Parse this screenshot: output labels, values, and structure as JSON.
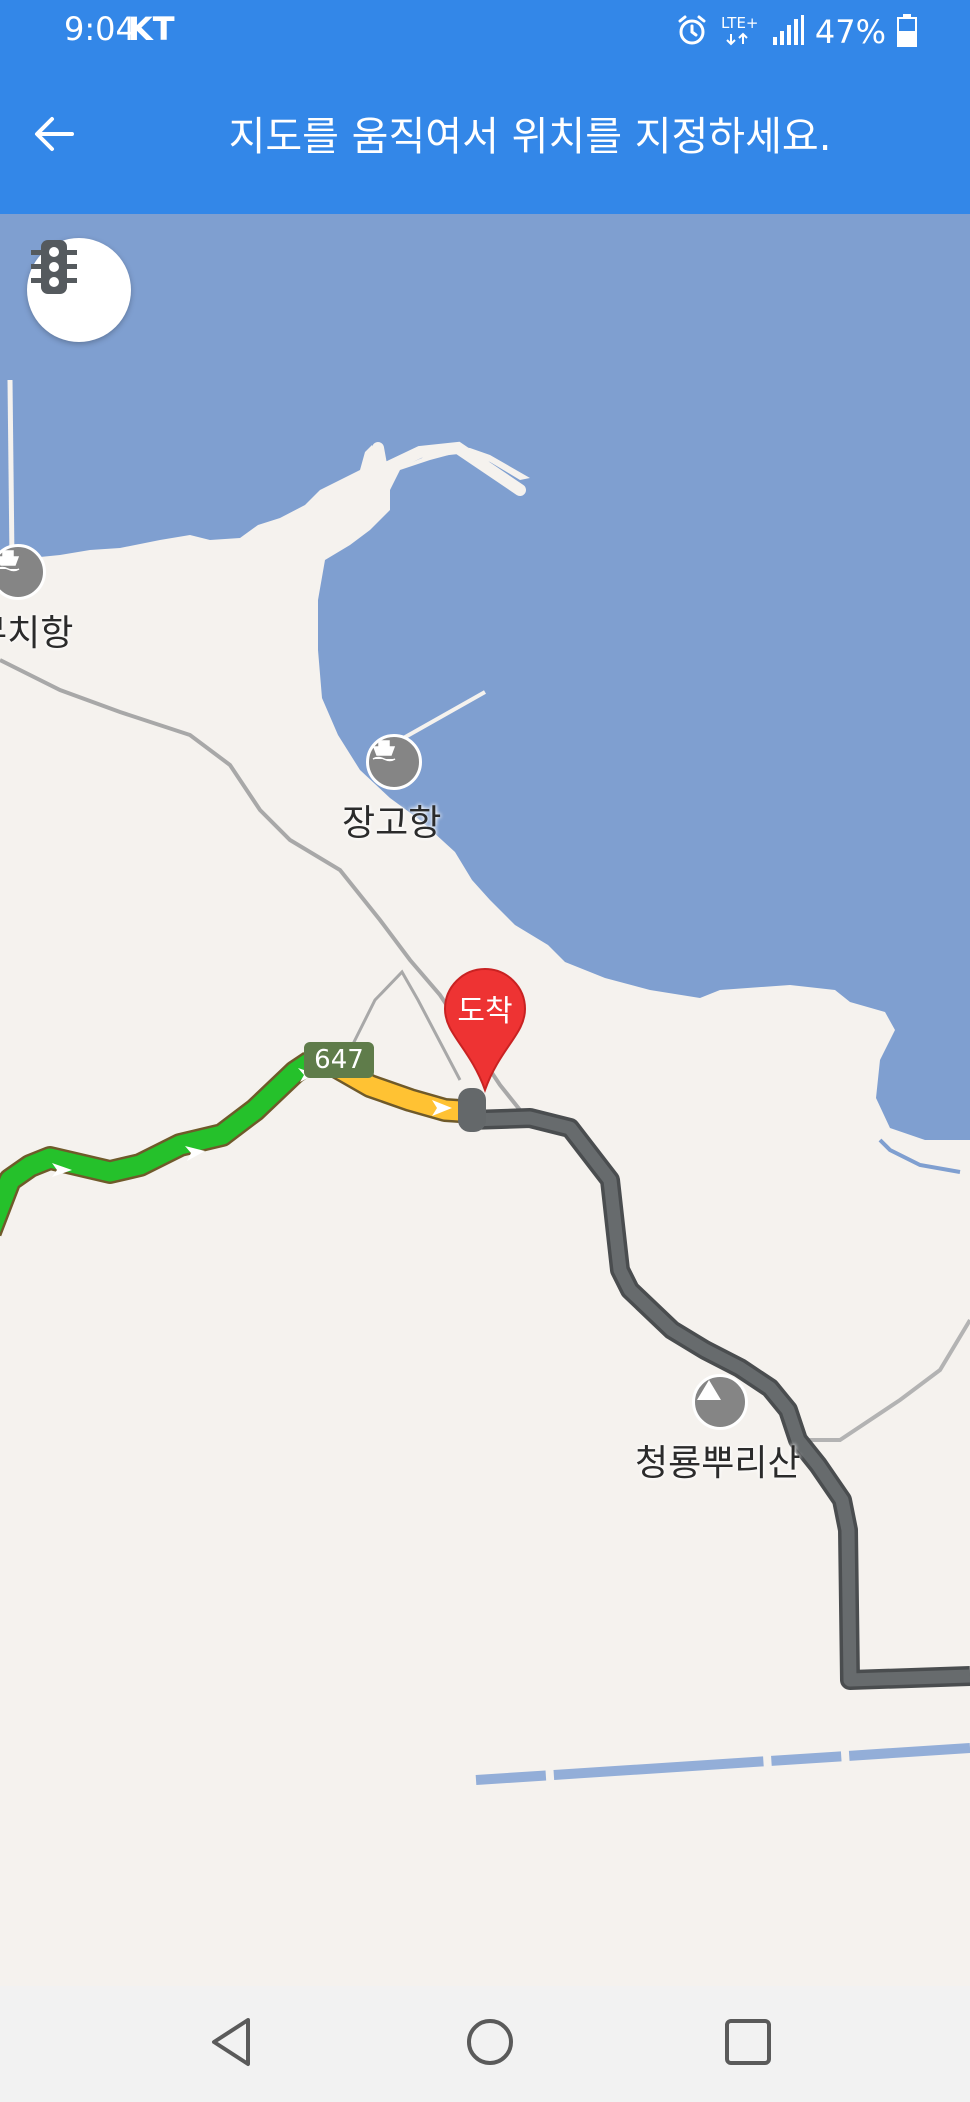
{
  "status_bar": {
    "time": "9:04",
    "carrier": "KT",
    "network": "LTE+",
    "battery": "47%",
    "icons": [
      "alarm-icon",
      "lte-icon",
      "signal-icon",
      "battery-icon"
    ]
  },
  "header": {
    "back_icon": "arrow-left-icon",
    "title": "지도를 움직여서 위치를 지정하세요."
  },
  "map": {
    "traffic_button_icon": "traffic-light-icon",
    "pois": [
      {
        "name": "무치항",
        "icon": "ferry-icon"
      },
      {
        "name": "장고항",
        "icon": "ferry-icon"
      },
      {
        "name": "청룡뿌리산",
        "icon": "mountain-icon"
      }
    ],
    "route_number": "647",
    "destination_label": "도착"
  },
  "nav_bar": {
    "icons": [
      "back-triangle-icon",
      "home-circle-icon",
      "recents-square-icon"
    ]
  },
  "colors": {
    "header": "#3387e8",
    "sea": "#7f9fd0",
    "land": "#f5f2ee",
    "route_green": "#25c12b",
    "route_yellow": "#ffc233",
    "route_gray": "#636769",
    "pin_red": "#ee3333"
  }
}
